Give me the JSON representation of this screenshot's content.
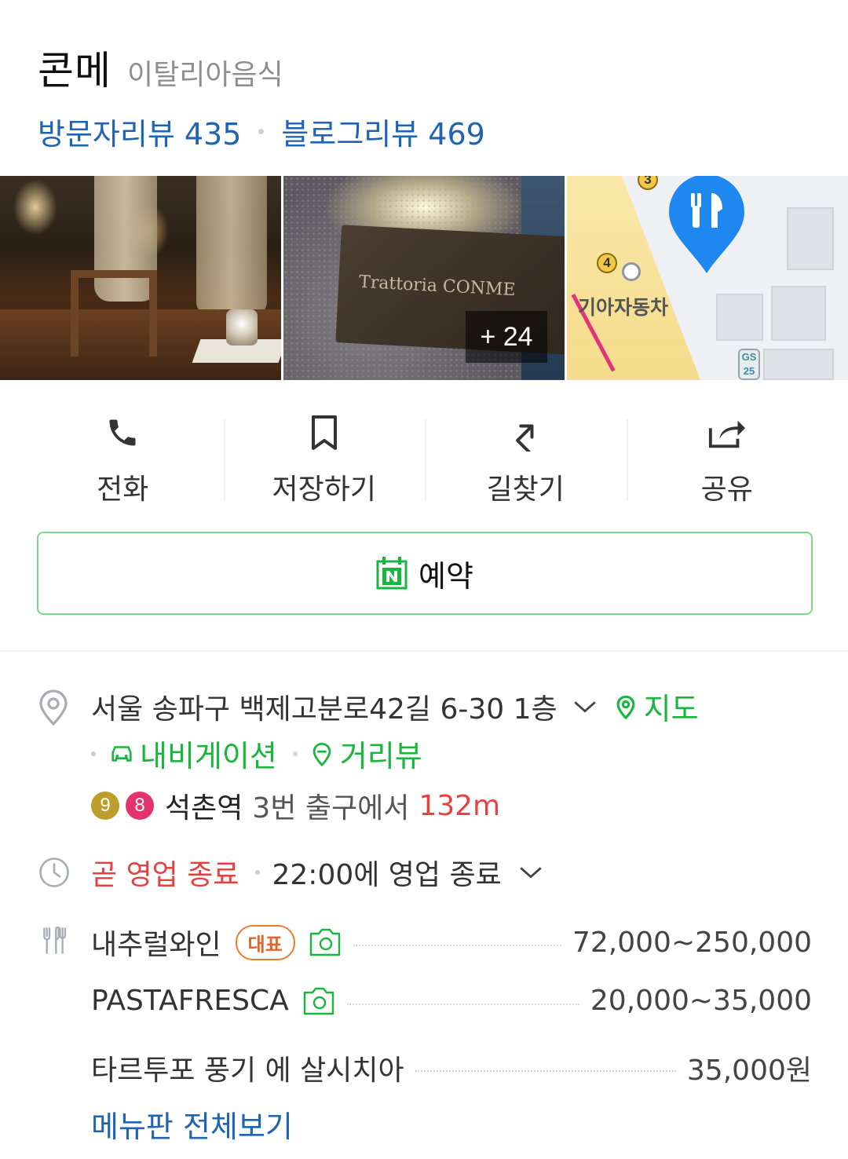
{
  "place": {
    "name": "콘메",
    "category": "이탈리아음식",
    "visitor_review": "방문자리뷰 435",
    "blog_review": "블로그리뷰 469"
  },
  "photos": {
    "sign_text": "Trattoria CONME",
    "more_count": "+ 24",
    "map_poi": "기아자동차",
    "map_numbers": [
      "3",
      "4"
    ],
    "gs_label": "GS 25"
  },
  "actions": [
    {
      "label": "전화",
      "icon": "phone-icon"
    },
    {
      "label": "저장하기",
      "icon": "bookmark-icon"
    },
    {
      "label": "길찾기",
      "icon": "directions-icon"
    },
    {
      "label": "공유",
      "icon": "share-icon"
    }
  ],
  "reserve": {
    "label": "예약",
    "icon": "naver-calendar-icon"
  },
  "address": {
    "text": "서울 송파구 백제고분로42길 6-30 1층",
    "map_label": "지도",
    "navigation_label": "내비게이션",
    "street_view_label": "거리뷰"
  },
  "subway": {
    "lines": [
      {
        "label": "9",
        "color": "#bd9e2a"
      },
      {
        "label": "8",
        "color": "#e4346f"
      }
    ],
    "station": "석촌역",
    "exit": "3번 출구에서",
    "distance": "132m"
  },
  "hours": {
    "status": "곧 영업 종료",
    "time": "22:00에 영업 종료"
  },
  "menu": {
    "items": [
      {
        "name": "내추럴와인",
        "badge": "대표",
        "price": "72,000~250,000"
      },
      {
        "name": "PASTAFRESCA",
        "badge": "",
        "price": "20,000~35,000"
      },
      {
        "name": "타르투포 풍기 에 살시치아",
        "badge": "",
        "price": "35,000원"
      }
    ],
    "view_all": "메뉴판 전체보기"
  },
  "colors": {
    "link_blue": "#1f64b3",
    "naver_green": "#18b63d",
    "alert_red": "#e64141",
    "badge_orange": "#f07b2b"
  }
}
